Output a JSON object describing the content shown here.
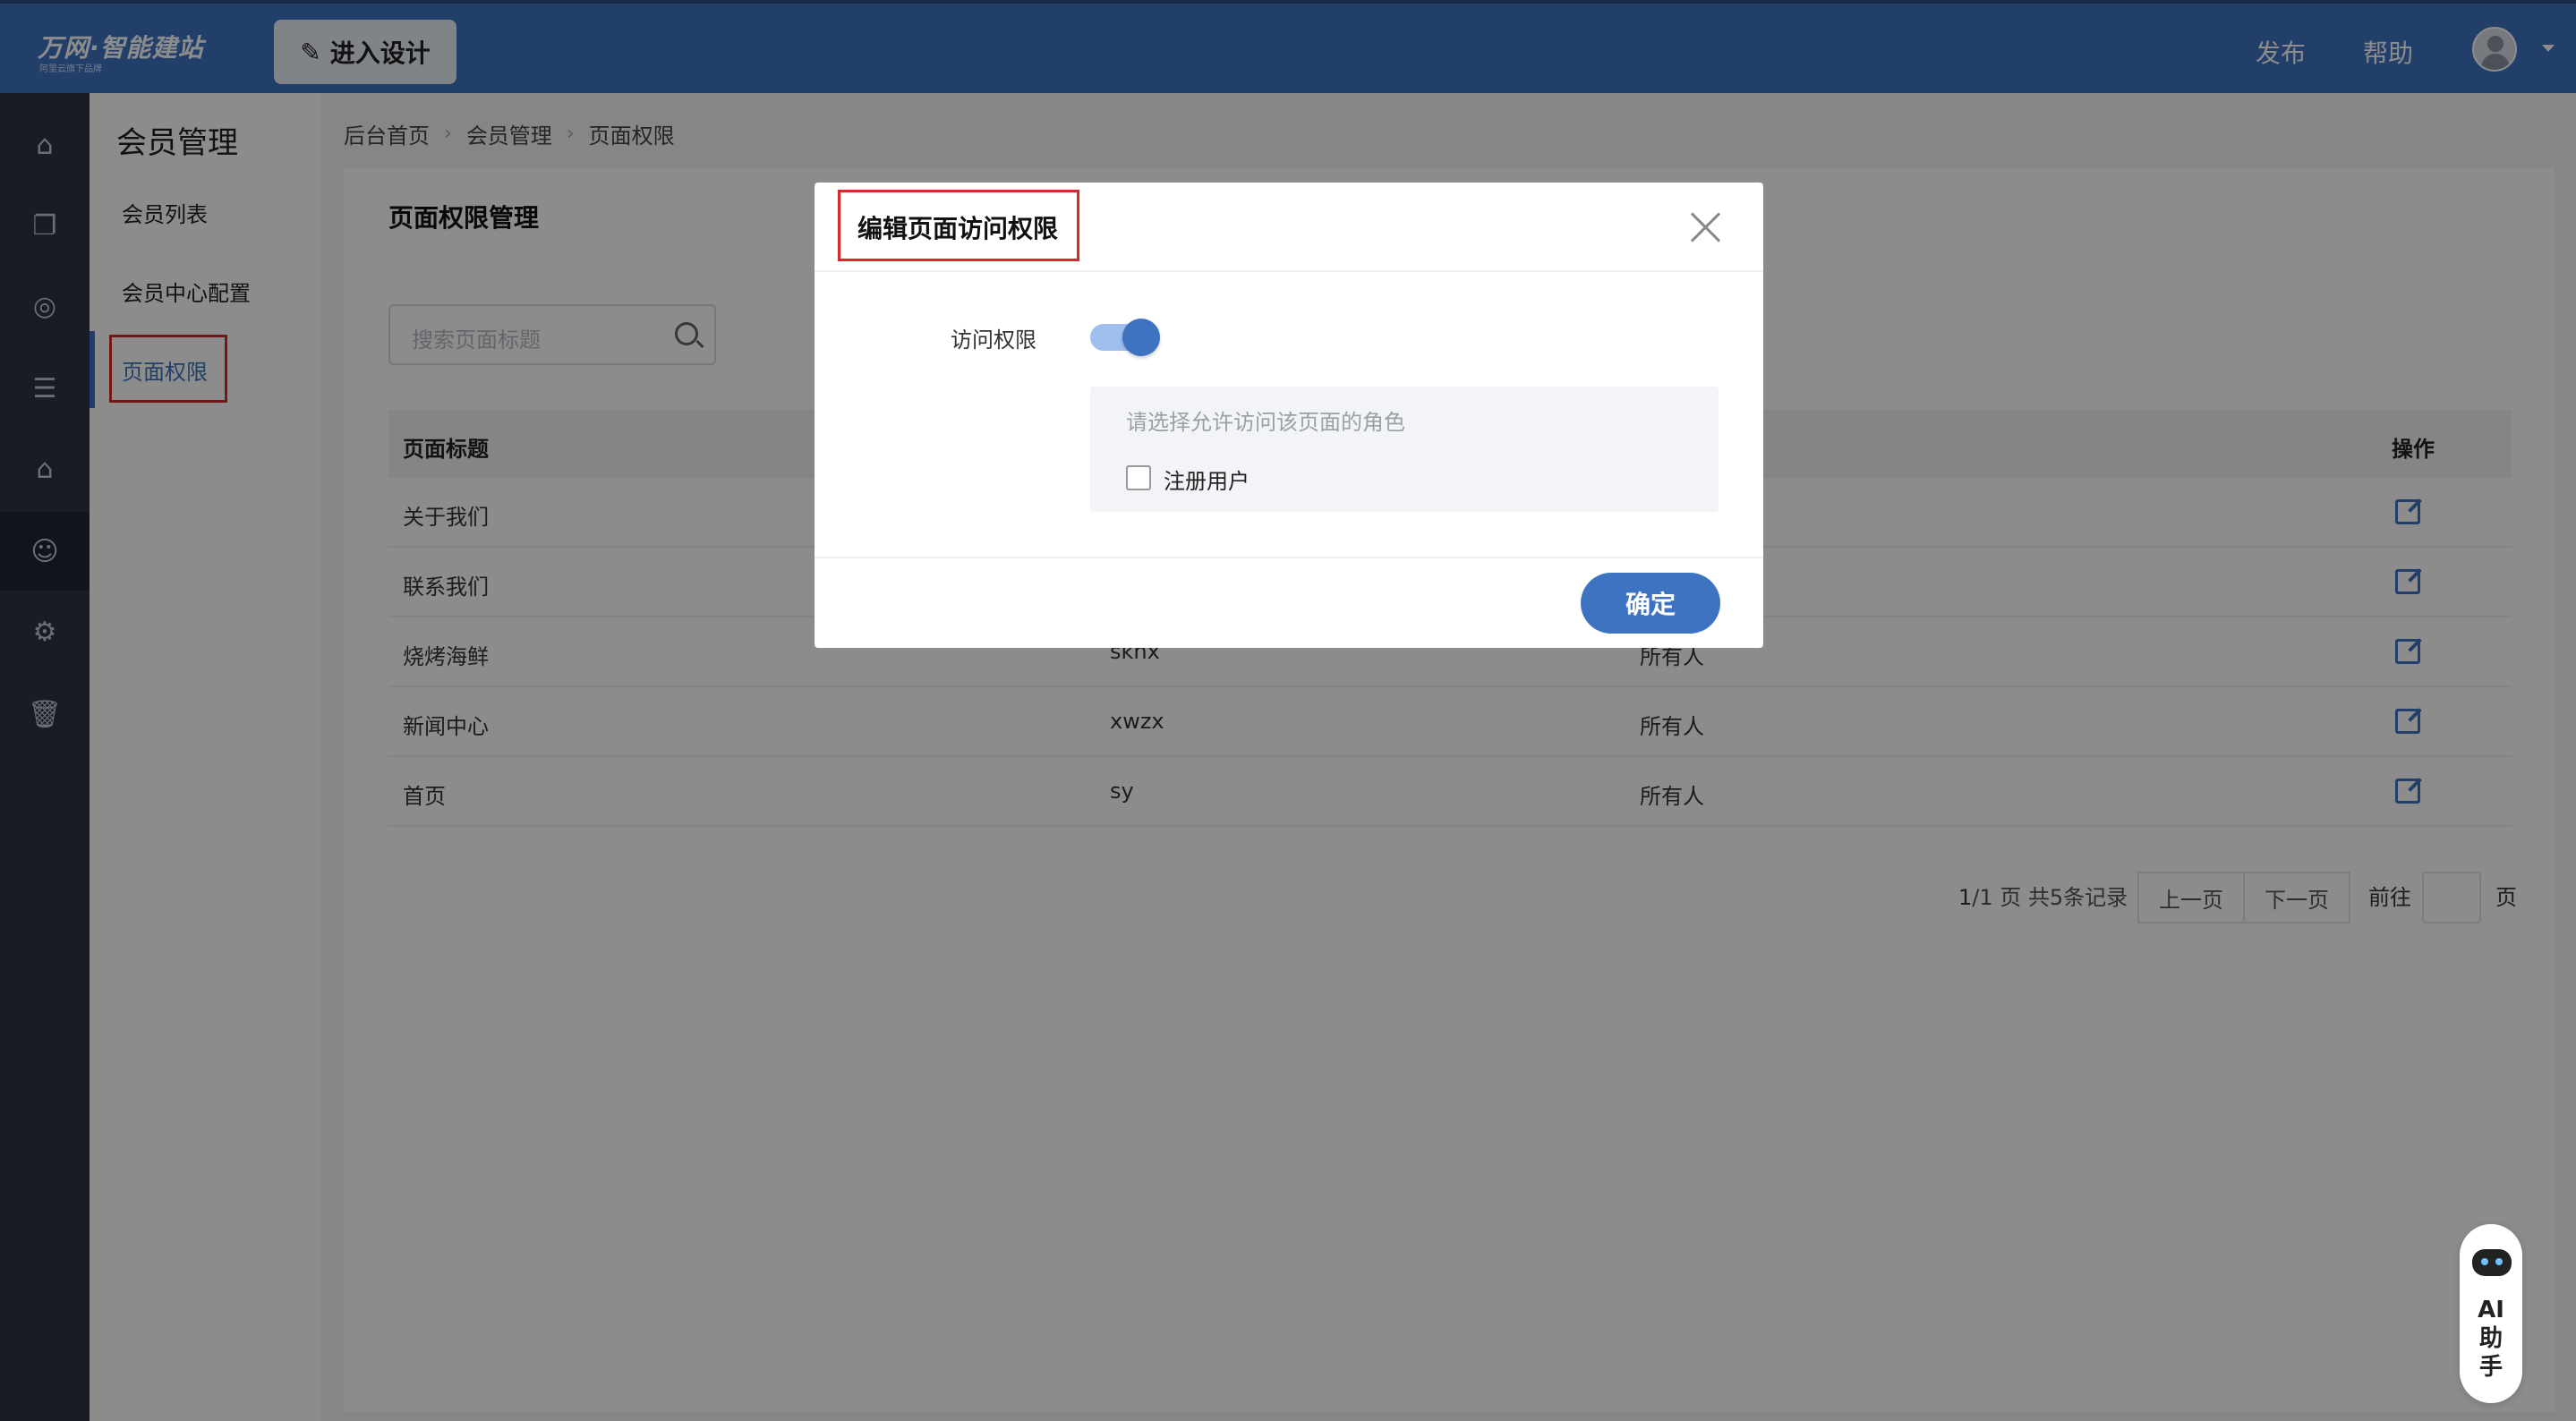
{
  "header": {
    "logo": "万网·智能建站",
    "logo_sub": "阿里云旗下品牌",
    "design_button": "进入设计",
    "publish": "发布",
    "help": "帮助"
  },
  "rail": {
    "icons": [
      "home-icon",
      "pages-icon",
      "planet-icon",
      "list-icon",
      "shop-icon",
      "member-icon",
      "settings-icon",
      "trash-icon"
    ]
  },
  "submenu": {
    "title": "会员管理",
    "items": [
      {
        "label": "会员列表"
      },
      {
        "label": "会员中心配置"
      },
      {
        "label": "页面权限",
        "active": true
      }
    ]
  },
  "breadcrumb": [
    "后台首页",
    "会员管理",
    "页面权限"
  ],
  "panel": {
    "title": "页面权限管理",
    "search_placeholder": "搜索页面标题",
    "columns": [
      "页面标题",
      "操作"
    ],
    "rows": [
      {
        "title": "关于我们",
        "alias": "",
        "access": ""
      },
      {
        "title": "联系我们",
        "alias": "",
        "access": ""
      },
      {
        "title": "烧烤海鲜",
        "alias": "sknx",
        "access": "所有人"
      },
      {
        "title": "新闻中心",
        "alias": "xwzx",
        "access": "所有人"
      },
      {
        "title": "首页",
        "alias": "sy",
        "access": "所有人"
      }
    ],
    "pager": {
      "current": "1",
      "summary": "/1 页 共5条记录",
      "prev": "上一页",
      "next": "下一页",
      "goto_prefix": "前往",
      "goto_suffix": "页"
    }
  },
  "modal": {
    "title": "编辑页面访问权限",
    "perm_label": "访问权限",
    "toggle_on": true,
    "role_hint": "请选择允许访问该页面的角色",
    "role_option": "注册用户",
    "confirm": "确定"
  },
  "ai_helper": {
    "label": "AI助手"
  },
  "colors": {
    "brand": "#3e73c2",
    "highlight_box": "#d8282a"
  }
}
